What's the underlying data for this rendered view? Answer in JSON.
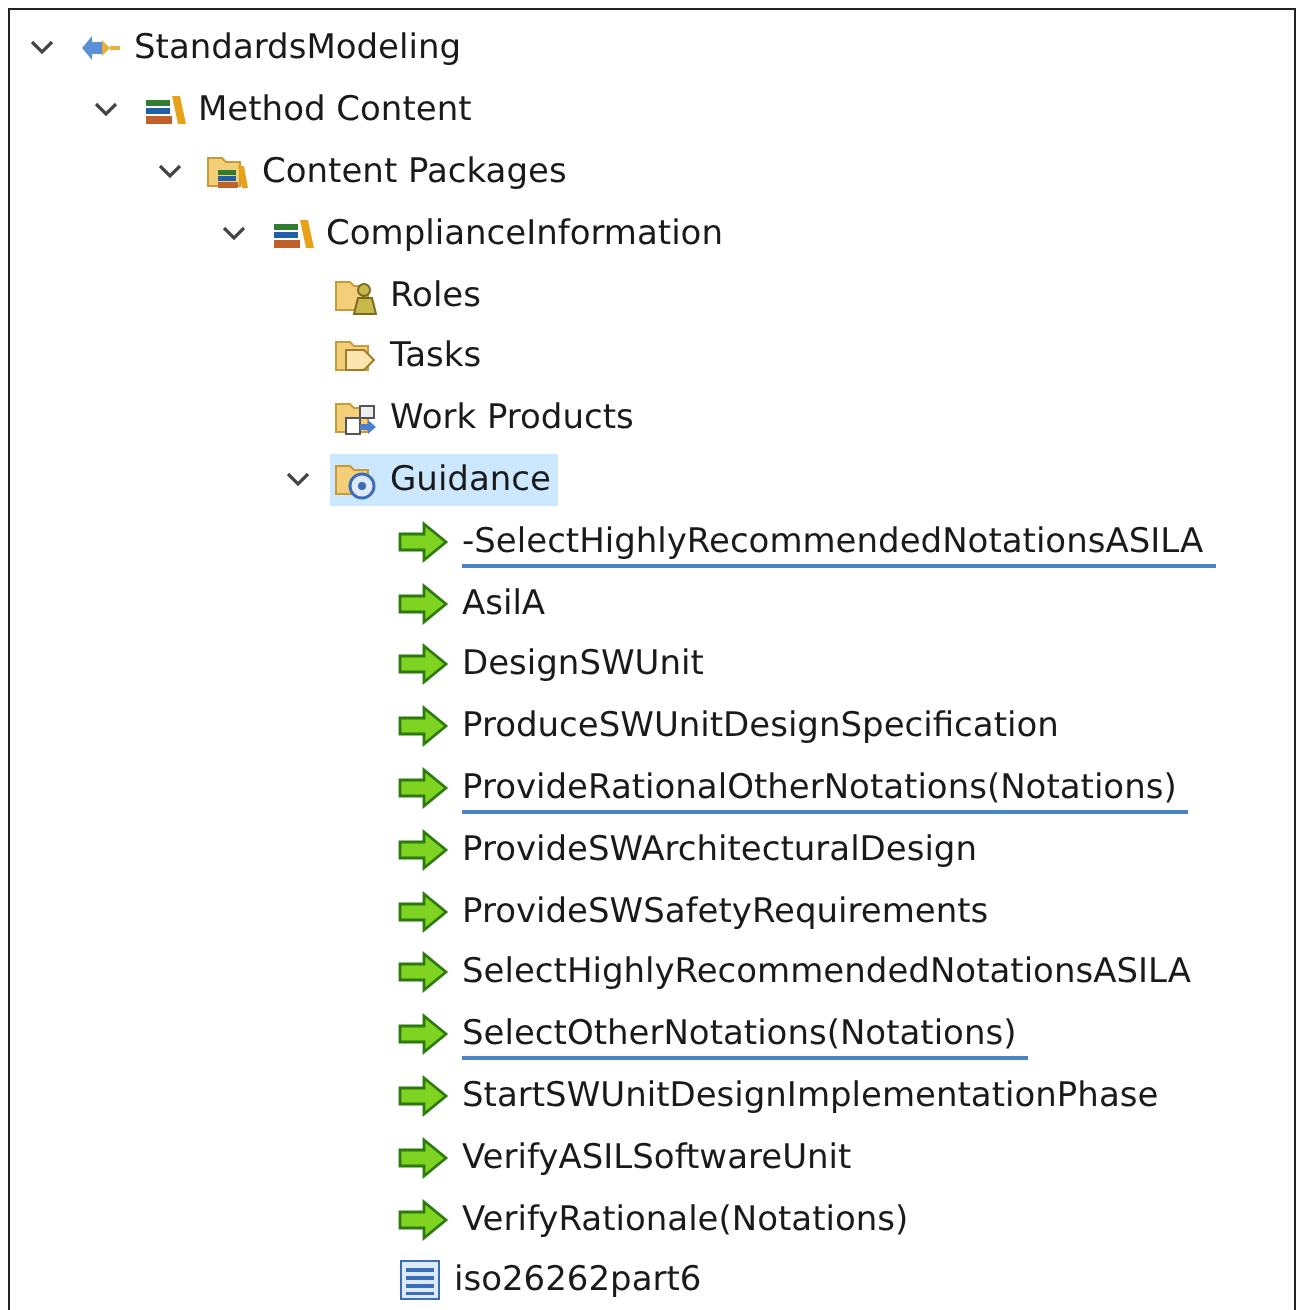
{
  "tree": [
    {
      "label": "StandardsModeling",
      "kind": "model",
      "expanded": true,
      "selected": false,
      "children": [
        {
          "label": "Method Content",
          "kind": "library",
          "expanded": true,
          "selected": false,
          "children": [
            {
              "label": "Content Packages",
              "kind": "package-folder",
              "expanded": true,
              "selected": false,
              "children": [
                {
                  "label": "ComplianceInformation",
                  "kind": "library",
                  "expanded": true,
                  "selected": false,
                  "children": [
                    {
                      "label": "Roles",
                      "kind": "roles-folder",
                      "selected": false
                    },
                    {
                      "label": "Tasks",
                      "kind": "tasks-folder",
                      "selected": false
                    },
                    {
                      "label": "Work Products",
                      "kind": "products-folder",
                      "selected": false
                    },
                    {
                      "label": "Guidance",
                      "kind": "guidance-folder",
                      "expanded": true,
                      "selected": true,
                      "children": [
                        {
                          "label": "-SelectHighlyRecommendedNotationsASILA",
                          "kind": "arrow",
                          "selected": false,
                          "underlined": true
                        },
                        {
                          "label": "AsilA",
                          "kind": "arrow",
                          "selected": false,
                          "underlined": false
                        },
                        {
                          "label": "DesignSWUnit",
                          "kind": "arrow",
                          "selected": false,
                          "underlined": false
                        },
                        {
                          "label": "ProduceSWUnitDesignSpecification",
                          "kind": "arrow",
                          "selected": false,
                          "underlined": false
                        },
                        {
                          "label": "ProvideRationalOtherNotations(Notations)",
                          "kind": "arrow",
                          "selected": false,
                          "underlined": true
                        },
                        {
                          "label": "ProvideSWArchitecturalDesign",
                          "kind": "arrow",
                          "selected": false,
                          "underlined": false
                        },
                        {
                          "label": "ProvideSWSafetyRequirements",
                          "kind": "arrow",
                          "selected": false,
                          "underlined": false
                        },
                        {
                          "label": "SelectHighlyRecommendedNotationsASILA",
                          "kind": "arrow",
                          "selected": false,
                          "underlined": false
                        },
                        {
                          "label": "SelectOtherNotations(Notations)",
                          "kind": "arrow",
                          "selected": false,
                          "underlined": true
                        },
                        {
                          "label": "StartSWUnitDesignImplementationPhase",
                          "kind": "arrow",
                          "selected": false,
                          "underlined": false
                        },
                        {
                          "label": "VerifyASILSoftwareUnit",
                          "kind": "arrow",
                          "selected": false,
                          "underlined": false
                        },
                        {
                          "label": "VerifyRationale(Notations)",
                          "kind": "arrow",
                          "selected": false,
                          "underlined": false
                        },
                        {
                          "label": "iso26262part6",
                          "kind": "document",
                          "selected": false,
                          "underlined": false
                        }
                      ]
                    }
                  ]
                }
              ]
            }
          ]
        }
      ]
    }
  ]
}
